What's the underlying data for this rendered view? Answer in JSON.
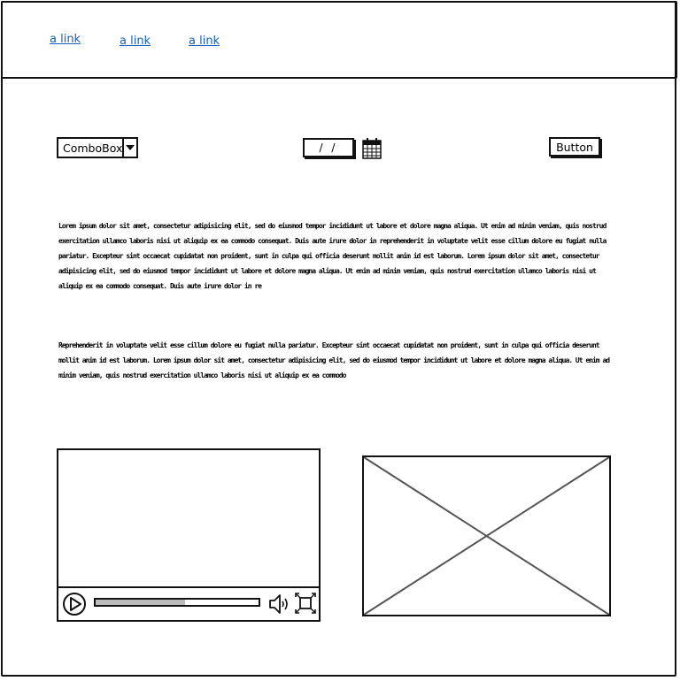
{
  "header": {
    "links": [
      "a link",
      "a link",
      "a link"
    ]
  },
  "toolbar": {
    "combobox_value": "ComboBox",
    "date_value": "/ /",
    "button_label": "Button"
  },
  "content": {
    "paragraph1": "Lorem ipsum dolor sit amet, consectetur adipisicing elit, sed do eiusmod tempor incididunt ut labore et dolore magna aliqua. Ut enim ad minim veniam, quis nostrud exercitation ullamco laboris nisi ut aliquip ex ea commodo consequat. Duis aute irure dolor in reprehenderit in voluptate velit esse cillum dolore eu fugiat nulla pariatur. Excepteur sint occaecat cupidatat non proident, sunt in culpa qui officia deserunt mollit anim id est laborum. Lorem ipsum dolor sit amet, consectetur adipisicing elit, sed do eiusmod tempor incididunt ut labore et dolore magna aliqua. Ut enim ad minim veniam, quis nostrud exercitation ullamco laboris nisi ut aliquip ex ea commodo consequat. Duis aute irure dolor in re",
    "paragraph2": "Reprehenderit in voluptate velit esse cillum dolore eu fugiat nulla pariatur. Excepteur sint occaecat cupidatat non proident, sunt in culpa qui officia deserunt mollit anim id est laborum. Lorem ipsum dolor sit amet, consectetur adipisicing elit, sed do eiusmod tempor incididunt ut labore et dolore magna aliqua. Ut enim ad minim veniam, quis nostrud exercitation ullamco laboris nisi ut aliquip ex ea commodo"
  },
  "video": {
    "progress": 0.55
  },
  "colors": {
    "link": "#1a5fb4",
    "stroke": "#111111",
    "progress_fill": "#bbbbbb"
  },
  "icons": [
    "chevron-down-icon",
    "calendar-icon",
    "play-icon",
    "volume-icon",
    "fullscreen-icon"
  ]
}
